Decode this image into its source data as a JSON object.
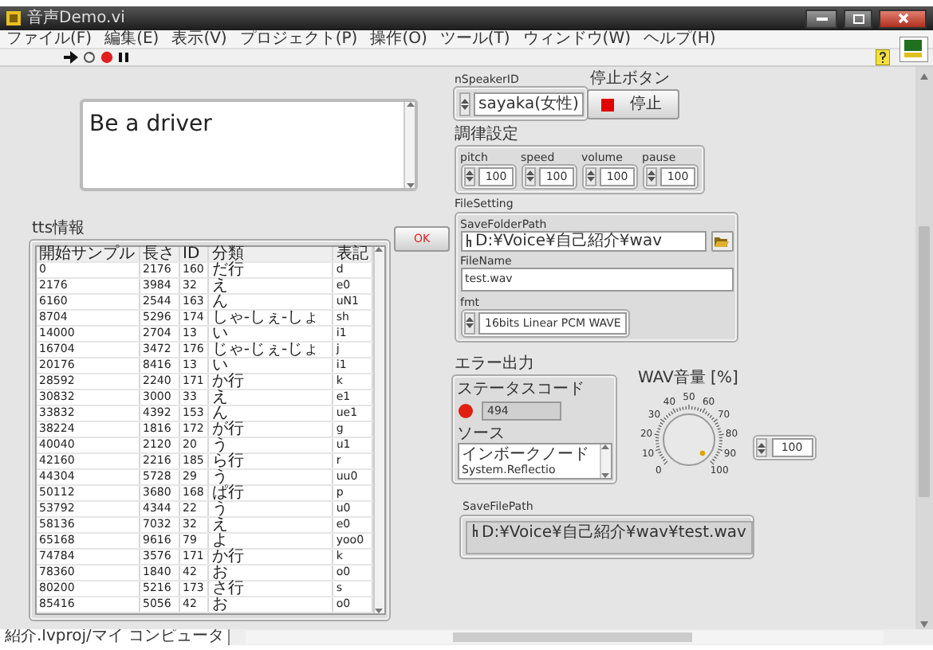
{
  "window": {
    "title": "音声Demo.vi"
  },
  "menu": [
    "ファイル(F)",
    "編集(E)",
    "表示(V)",
    "プロジェクト(P)",
    "操作(O)",
    "ツール(T)",
    "ウィンドウ(W)",
    "ヘルプ(H)"
  ],
  "text_input": {
    "value": "Be a driver"
  },
  "ok_button": {
    "label": "OK"
  },
  "tts_info": {
    "label": "tts情報",
    "columns": [
      "開始サンプル",
      "長さ",
      "ID",
      "分類",
      "表記"
    ],
    "rows": [
      [
        "0",
        "2176",
        "160",
        "だ行",
        "d"
      ],
      [
        "2176",
        "3984",
        "32",
        "え",
        "e0"
      ],
      [
        "6160",
        "2544",
        "163",
        "ん",
        "uN1"
      ],
      [
        "8704",
        "5296",
        "174",
        "しゃ-しぇ-しょ",
        "sh"
      ],
      [
        "14000",
        "2704",
        "13",
        "い",
        "i1"
      ],
      [
        "16704",
        "3472",
        "176",
        "じゃ-じぇ-じょ",
        "j"
      ],
      [
        "20176",
        "8416",
        "13",
        "い",
        "i1"
      ],
      [
        "28592",
        "2240",
        "171",
        "か行",
        "k"
      ],
      [
        "30832",
        "3000",
        "33",
        "え",
        "e1"
      ],
      [
        "33832",
        "4392",
        "153",
        "ん",
        "ue1"
      ],
      [
        "38224",
        "1816",
        "172",
        "が行",
        "g"
      ],
      [
        "40040",
        "2120",
        "20",
        "う",
        "u1"
      ],
      [
        "42160",
        "2216",
        "185",
        "ら行",
        "r"
      ],
      [
        "44304",
        "5728",
        "29",
        "う",
        "uu0"
      ],
      [
        "50112",
        "3680",
        "168",
        "ぱ行",
        "p"
      ],
      [
        "53792",
        "4344",
        "22",
        "う",
        "u0"
      ],
      [
        "58136",
        "7032",
        "32",
        "え",
        "e0"
      ],
      [
        "65168",
        "9616",
        "79",
        "よ",
        "yoo0"
      ],
      [
        "74784",
        "3576",
        "171",
        "か行",
        "k"
      ],
      [
        "78360",
        "1840",
        "42",
        "お",
        "o0"
      ],
      [
        "80200",
        "5216",
        "173",
        "さ行",
        "s"
      ],
      [
        "85416",
        "5056",
        "42",
        "お",
        "o0"
      ]
    ]
  },
  "speaker_id": {
    "label": "nSpeakerID",
    "value": "sayaka(女性)"
  },
  "stop_button": {
    "label": "停止ボタン",
    "text": "停止"
  },
  "tuning": {
    "label": "調律設定",
    "params": [
      {
        "label": "pitch",
        "value": "100"
      },
      {
        "label": "speed",
        "value": "100"
      },
      {
        "label": "volume",
        "value": "100"
      },
      {
        "label": "pause",
        "value": "100"
      }
    ]
  },
  "file_setting": {
    "label": "FileSetting",
    "save_folder_path": {
      "label": "SaveFolderPath",
      "value": "D:¥Voice¥自己紹介¥wav"
    },
    "file_name": {
      "label": "FileName",
      "value": "test.wav"
    },
    "fmt": {
      "label": "fmt",
      "value": "16bits Linear PCM WAVE"
    }
  },
  "error_out": {
    "label": "エラー出力",
    "status_label": "ステータスコード",
    "status": true,
    "code": "494",
    "source_label": "ソース",
    "source_lines": [
      "インボークノード",
      "System.Reflectio"
    ]
  },
  "wav_volume": {
    "label": "WAV音量 [%]",
    "scale": [
      "0",
      "10",
      "20",
      "30",
      "40",
      "50",
      "60",
      "70",
      "80",
      "90",
      "100"
    ],
    "value": "100"
  },
  "save_file_path": {
    "label": "SaveFilePath",
    "value": "D:¥Voice¥自己紹介¥wav¥test.wav"
  },
  "status_bar": {
    "project": "紹介.lvproj/マイ コンピュータ"
  }
}
